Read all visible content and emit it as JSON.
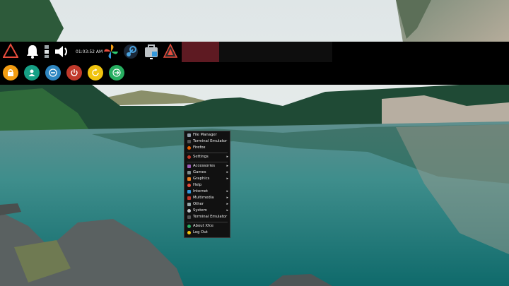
{
  "wallpaper": {
    "subject": "mountain lake with forest and rocks"
  },
  "panel": {
    "clock": "01:03:52 AM",
    "left_icons": [
      "warning-triangle-icon",
      "bell-icon",
      "network-icon",
      "volume-icon",
      "pinwheel-icon",
      "steam-icon",
      "software-store-icon",
      "arch-logo-icon"
    ],
    "session_buttons": [
      {
        "name": "lock-button",
        "icon": "lock-icon",
        "color": "#f39c12"
      },
      {
        "name": "switch-user-button",
        "icon": "user-icon",
        "color": "#16a085"
      },
      {
        "name": "suspend-button",
        "icon": "minus-circle-icon",
        "color": "#2e86c1"
      },
      {
        "name": "shutdown-button",
        "icon": "power-icon",
        "color": "#c0392b"
      },
      {
        "name": "restart-button",
        "icon": "refresh-icon",
        "color": "#f1c40f"
      },
      {
        "name": "logout-button",
        "icon": "arrow-right-icon",
        "color": "#27ae60"
      }
    ],
    "active_task_color": "#5e1a22"
  },
  "menu": {
    "top": [
      {
        "label": "File Manager",
        "icon": "folder-icon",
        "color": "#8e9aa6"
      },
      {
        "label": "Terminal Emulator",
        "icon": "terminal-icon",
        "color": "#555"
      },
      {
        "label": "Firefox",
        "icon": "firefox-icon",
        "color": "#e66000"
      }
    ],
    "settings": {
      "label": "Settings",
      "icon": "settings-icon",
      "color": "#c0392b"
    },
    "categories": [
      {
        "label": "Accessories",
        "icon": "accessories-icon",
        "color": "#9b59b6"
      },
      {
        "label": "Games",
        "icon": "games-icon",
        "color": "#7f8c8d"
      },
      {
        "label": "Graphics",
        "icon": "graphics-icon",
        "color": "#e67e22"
      },
      {
        "label": "Help",
        "icon": "help-icon",
        "color": "#e74c3c"
      },
      {
        "label": "Internet",
        "icon": "internet-icon",
        "color": "#3498db"
      },
      {
        "label": "Multimedia",
        "icon": "multimedia-icon",
        "color": "#c0392b"
      },
      {
        "label": "Other",
        "icon": "other-icon",
        "color": "#95a5a6"
      },
      {
        "label": "System",
        "icon": "system-icon",
        "color": "#bdc3c7"
      }
    ],
    "terminal": {
      "label": "Terminal Emulator",
      "icon": "terminal-icon",
      "color": "#555"
    },
    "bottom": [
      {
        "label": "About Xfce",
        "icon": "about-icon",
        "color": "#27ae60"
      },
      {
        "label": "Log Out",
        "icon": "logout-icon",
        "color": "#f1c40f"
      }
    ],
    "submenu_arrow": "▸"
  }
}
